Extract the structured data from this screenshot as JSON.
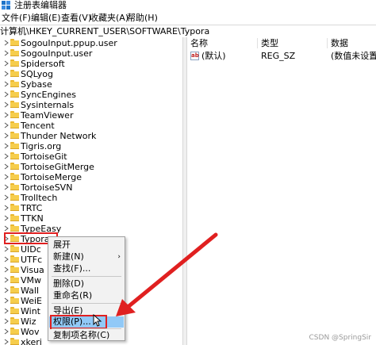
{
  "window": {
    "title": "注册表编辑器"
  },
  "menu": [
    "文件(F)",
    "编辑(E)",
    "查看(V)",
    "收藏夹(A)",
    "帮助(H)"
  ],
  "address": "计算机\\HKEY_CURRENT_USER\\SOFTWARE\\Typora",
  "tree": {
    "items": [
      "SogouInput.ppup.user",
      "SogouInput.user",
      "Spidersoft",
      "SQLyog",
      "Sybase",
      "SyncEngines",
      "Sysinternals",
      "TeamViewer",
      "Tencent",
      "Thunder Network",
      "Tigris.org",
      "TortoiseGit",
      "TortoiseGitMerge",
      "TortoiseMerge",
      "TortoiseSVN",
      "Trolltech",
      "TRTC",
      "TTKN",
      "TypeEasy",
      "Typora",
      "UIDc",
      "UTFc",
      "Visua",
      "VMw",
      "Wall",
      "WeiE",
      "Wint",
      "Wiz",
      "Wov",
      "xkeri"
    ]
  },
  "list": {
    "headers": {
      "name": "名称",
      "type": "类型",
      "data": "数据"
    },
    "rows": [
      {
        "name": "(默认)",
        "type": "REG_SZ",
        "data": "(数值未设置)"
      }
    ]
  },
  "context_menu": {
    "items": [
      {
        "label": "展开"
      },
      {
        "label": "新建(N)",
        "submenu": true
      },
      {
        "label": "查找(F)..."
      },
      {
        "label": "删除(D)"
      },
      {
        "label": "重命名(R)"
      },
      {
        "label": "导出(E)"
      },
      {
        "label": "权限(P)...",
        "highlighted": true
      },
      {
        "label": "复制项名称(C)"
      }
    ],
    "submenu_glyph": "›"
  },
  "watermark": "CSDN @SpringSir",
  "colors": {
    "highlight": "#91c9f7",
    "annotation_red": "#e02020",
    "folder": "#f6cd4c"
  }
}
